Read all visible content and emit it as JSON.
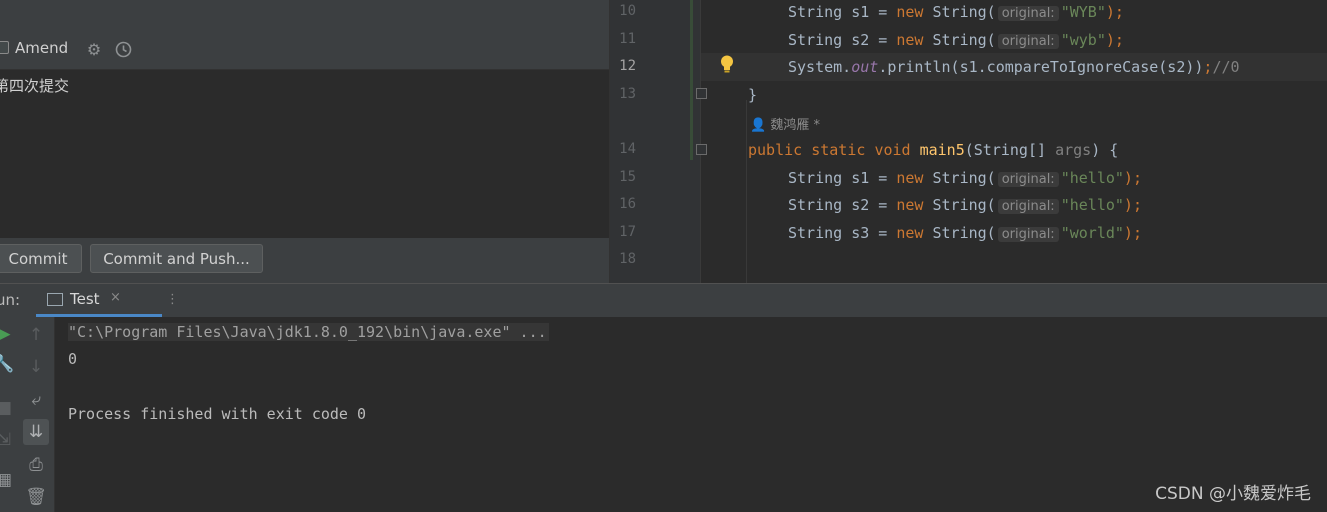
{
  "commit_panel": {
    "amend_label": "Amend",
    "message": "第四次提交",
    "commit_label": "Commit",
    "commit_push_label": "Commit and Push..."
  },
  "editor": {
    "line_numbers": [
      "10",
      "11",
      "12",
      "13",
      "14",
      "15",
      "16",
      "17",
      "18"
    ],
    "author_hint": "魏鸿雁 *",
    "hint_label": "original:",
    "lines": {
      "l10": {
        "type": "String",
        "var": "s1",
        "eq": " = ",
        "kw": "new",
        "ctor": "String(",
        "arg": "\"WYB\"",
        "end": ");"
      },
      "l11": {
        "type": "String",
        "var": "s2",
        "eq": " = ",
        "kw": "new",
        "ctor": "String(",
        "arg": "\"wyb\"",
        "end": ");"
      },
      "l12": {
        "obj": "System.",
        "field": "out",
        "call": ".println(s1.compareToIgnoreCase(s2))",
        "semi": ";",
        "comment": "//0"
      },
      "l13": {
        "text": "}"
      },
      "l14": {
        "kw1": "public",
        "kw2": "static",
        "kw3": "void",
        "method": "main5",
        "params": "(String[] ",
        "param_name": "args",
        "close": ") {"
      },
      "l15": {
        "type": "String",
        "var": "s1",
        "eq": " = ",
        "kw": "new",
        "ctor": "String(",
        "arg": "\"hello\"",
        "end": ");"
      },
      "l16": {
        "type": "String",
        "var": "s2",
        "eq": " = ",
        "kw": "new",
        "ctor": "String(",
        "arg": "\"hello\"",
        "end": ");"
      },
      "l17": {
        "type": "String",
        "var": "s3",
        "eq": " = ",
        "kw": "new",
        "ctor": "String(",
        "arg": "\"world\"",
        "end": ");"
      }
    }
  },
  "run_window": {
    "run_label": "un:",
    "tab_label": "Test",
    "tab_close": "×",
    "more": "⋮",
    "console": {
      "command": "\"C:\\Program Files\\Java\\jdk1.8.0_192\\bin\\java.exe\" ...",
      "output": "0",
      "finished": "Process finished with exit code 0"
    }
  },
  "watermark": "CSDN @小魏爱炸毛",
  "colors": {
    "keyword": "#cc7832",
    "string": "#6a8759",
    "static_field": "#9876aa",
    "accent": "#4a88c7",
    "run_green": "#499c54"
  },
  "icons": [
    "gear-icon",
    "clock-icon",
    "bulb-icon",
    "rerun-icon",
    "wrench-icon",
    "stop-icon",
    "up-arrow-icon",
    "down-arrow-icon",
    "soft-wrap-icon",
    "scroll-to-end-icon",
    "print-icon",
    "trash-icon"
  ]
}
